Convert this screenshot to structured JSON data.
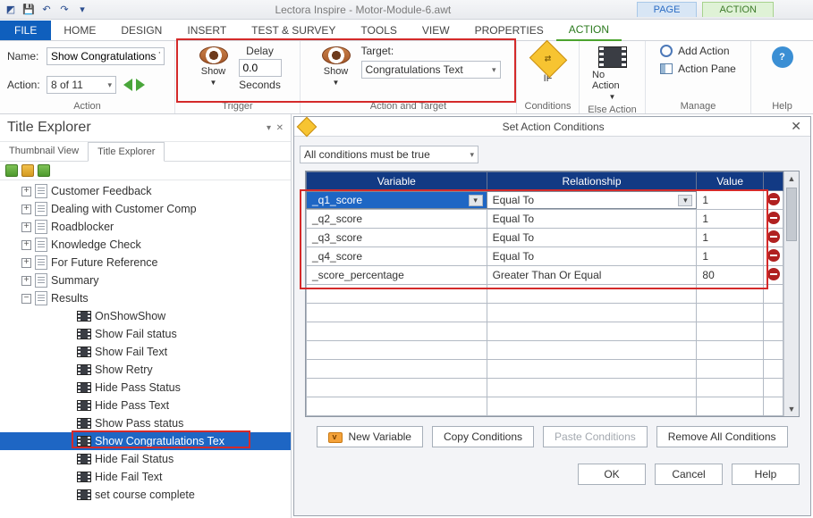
{
  "titlebar": {
    "title": "Lectora Inspire - Motor-Module-6.awt"
  },
  "ctx_tabs": {
    "page": "PAGE",
    "action": "ACTION"
  },
  "ribbon_tabs": [
    "FILE",
    "HOME",
    "DESIGN",
    "INSERT",
    "TEST & SURVEY",
    "TOOLS",
    "VIEW",
    "PROPERTIES",
    "ACTION"
  ],
  "ribbon": {
    "action": {
      "name_label": "Name:",
      "name_value": "Show Congratulations Tex",
      "action_label": "Action:",
      "action_value": "8 of 11",
      "group_label": "Action"
    },
    "trigger": {
      "show": "Show",
      "delay_label": "Delay",
      "delay_value": "0.0",
      "seconds": "Seconds",
      "group_label": "Trigger"
    },
    "target": {
      "show": "Show",
      "target_label": "Target:",
      "target_value": "Congratulations Text",
      "group_label": "Action and Target"
    },
    "conditions": {
      "if": "IF",
      "group_label": "Conditions"
    },
    "else": {
      "no_action": "No Action",
      "group_label": "Else Action"
    },
    "manage": {
      "add": "Add Action",
      "pane": "Action Pane",
      "group_label": "Manage"
    },
    "help": "Help"
  },
  "explorer": {
    "title": "Title Explorer",
    "tabs": {
      "thumb": "Thumbnail View",
      "title": "Title Explorer"
    },
    "pages": [
      "Customer Feedback",
      "Dealing with Customer Comp",
      "Roadblocker",
      "Knowledge Check",
      "For Future Reference",
      "Summary",
      "Results"
    ],
    "actions": [
      "OnShowShow",
      "Show Fail status",
      "Show Fail Text",
      "Show Retry",
      "Hide Pass Status",
      "Hide Pass Text",
      "Show Pass status",
      "Show Congratulations Tex",
      "Hide Fail Status",
      "Hide Fail Text",
      "set course complete"
    ]
  },
  "dialog": {
    "title": "Set Action Conditions",
    "mode": "All conditions must be true",
    "headers": {
      "var": "Variable",
      "rel": "Relationship",
      "val": "Value"
    },
    "rows": [
      {
        "var": "_q1_score",
        "rel": "Equal To",
        "val": "1"
      },
      {
        "var": "_q2_score",
        "rel": "Equal To",
        "val": "1"
      },
      {
        "var": "_q3_score",
        "rel": "Equal To",
        "val": "1"
      },
      {
        "var": "_q4_score",
        "rel": "Equal To",
        "val": "1"
      },
      {
        "var": "_score_percentage",
        "rel": "Greater Than Or Equal",
        "val": "80"
      }
    ],
    "buttons": {
      "new_var": "New Variable",
      "copy": "Copy Conditions",
      "paste": "Paste Conditions",
      "remove": "Remove All Conditions",
      "ok": "OK",
      "cancel": "Cancel",
      "help": "Help"
    }
  }
}
